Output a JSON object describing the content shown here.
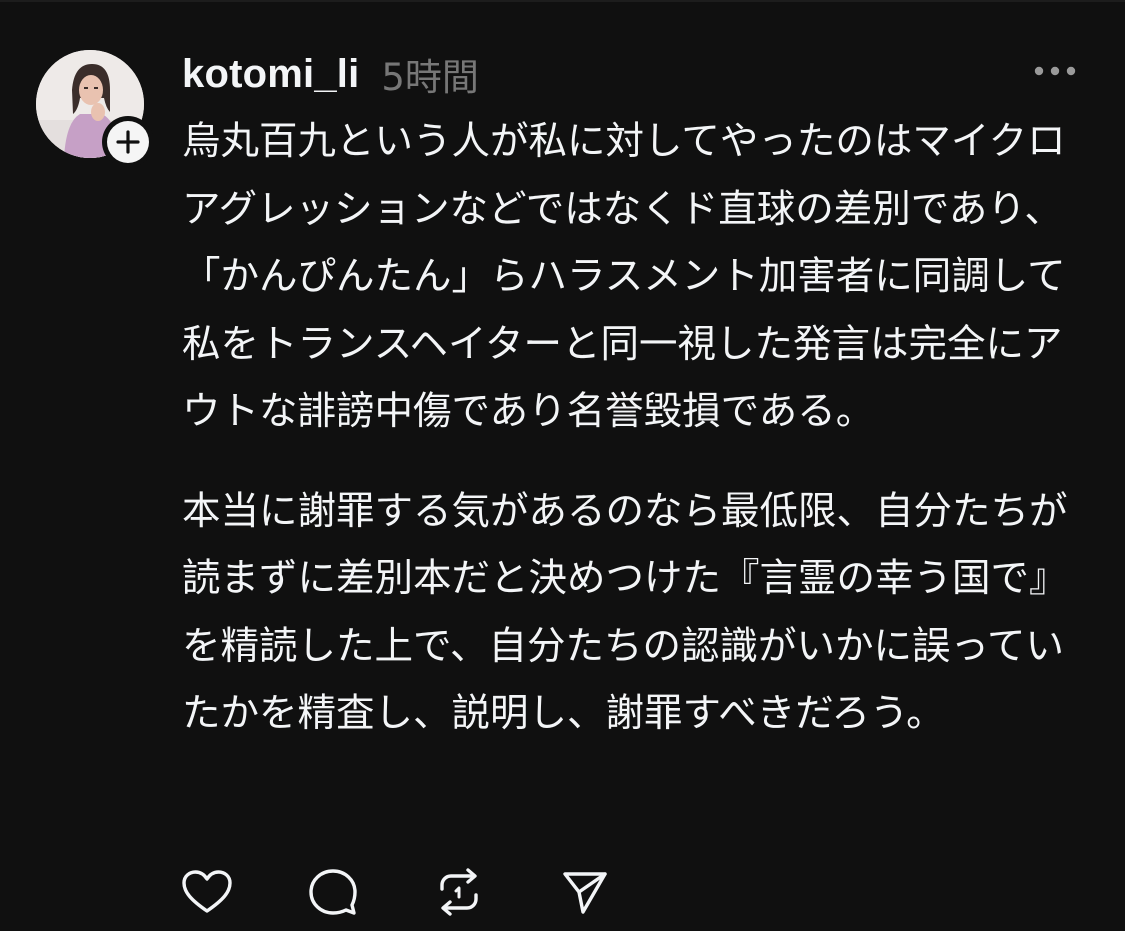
{
  "post": {
    "username": "kotomi_li",
    "timestamp": "5時間",
    "paragraphs": [
      "烏丸百九という人が私に対してやったのはマイクロアグレッションなどではなくド直球の差別であり、「かんぴんたん」らハラスメント加害者に同調して私をトランスヘイターと同一視した発言は完全にアウトな誹謗中傷であり名誉毀損である。",
      "本当に謝罪する気があるのなら最低限、自分たちが読まずに差別本だと決めつけた『言霊の幸う国で』を精読した上で、自分たちの認識がいかに誤っていたかを精査し、説明し、謝罪すべきだろう。"
    ]
  },
  "icons": {
    "avatar": "user-avatar-photo",
    "follow": "plus-icon",
    "more": "more-dots-icon",
    "like": "heart-icon",
    "comment": "comment-bubble-icon",
    "repost": "repost-icon",
    "share": "send-icon"
  },
  "colors": {
    "background": "#101010",
    "text": "#f3f5f7",
    "muted": "#777777"
  }
}
